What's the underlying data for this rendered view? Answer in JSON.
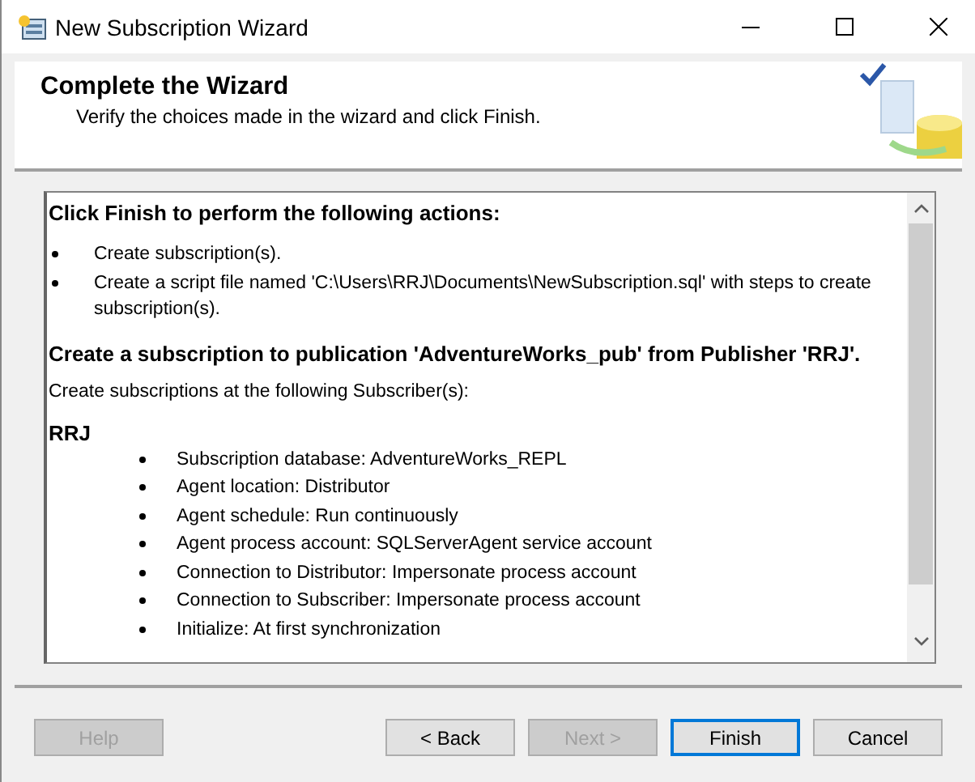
{
  "window": {
    "title": "New Subscription Wizard"
  },
  "header": {
    "title": "Complete the Wizard",
    "subtitle": "Verify the choices made in the wizard and click Finish."
  },
  "summary": {
    "intro": "Click Finish to perform the following actions:",
    "actions": [
      "Create subscription(s).",
      "Create a script file named 'C:\\Users\\RRJ\\Documents\\NewSubscription.sql' with steps to create subscription(s)."
    ],
    "publication_heading": "Create a subscription to publication 'AdventureWorks_pub' from Publisher 'RRJ'.",
    "subscribers_intro": "Create subscriptions at the following Subscriber(s):",
    "subscriber": "RRJ",
    "details": [
      "Subscription database: AdventureWorks_REPL",
      "Agent location: Distributor",
      "Agent schedule: Run continuously",
      "Agent process account: SQLServerAgent service account",
      "Connection to Distributor: Impersonate process account",
      "Connection to Subscriber: Impersonate process account",
      "Initialize: At first synchronization"
    ]
  },
  "buttons": [
    {
      "label": "Help",
      "disabled": true,
      "default": false,
      "kind": "help"
    },
    {
      "label": "< Back",
      "disabled": false,
      "default": false,
      "kind": "nav"
    },
    {
      "label": "Next >",
      "disabled": true,
      "default": false,
      "kind": "nav"
    },
    {
      "label": "Finish",
      "disabled": false,
      "default": true,
      "kind": "nav"
    },
    {
      "label": "Cancel",
      "disabled": false,
      "default": false,
      "kind": "nav"
    }
  ]
}
